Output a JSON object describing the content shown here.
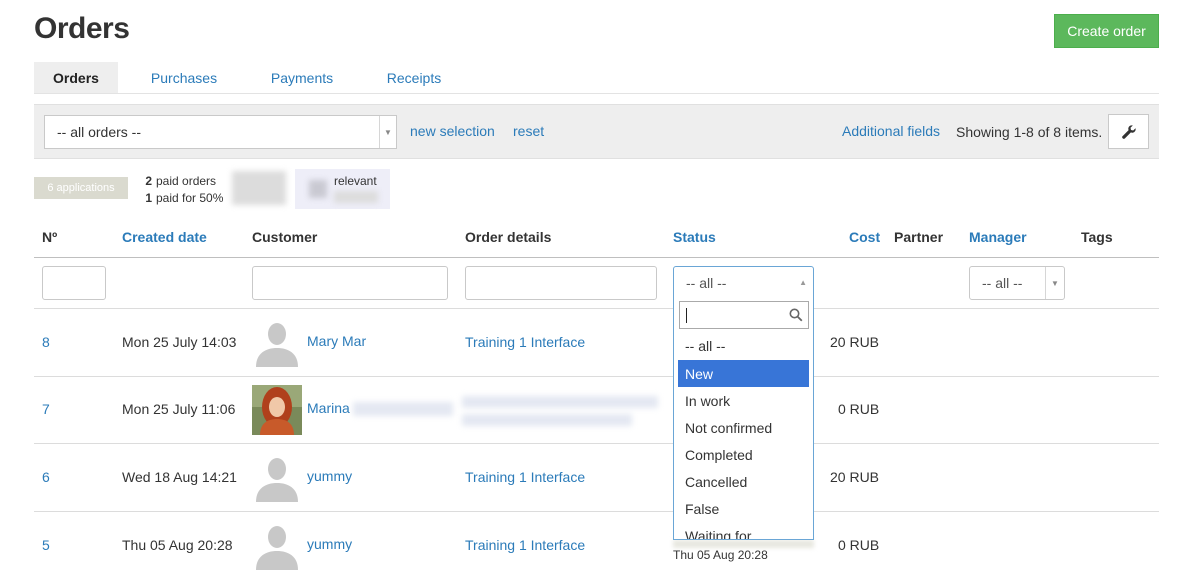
{
  "header": {
    "title": "Orders",
    "create_button": "Create order"
  },
  "tabs": [
    {
      "label": "Orders",
      "active": true
    },
    {
      "label": "Purchases"
    },
    {
      "label": "Payments"
    },
    {
      "label": "Receipts"
    }
  ],
  "filterbar": {
    "order_filter_value": "-- all orders --",
    "new_selection": "new selection",
    "reset": "reset",
    "additional_fields": "Additional fields",
    "showing": "Showing 1-8 of 8 items."
  },
  "summary": {
    "applications": "6 applications",
    "paid_orders_count": "2",
    "paid_orders_label": "paid orders",
    "paid_half_count": "1",
    "paid_half_label": "paid for 50%",
    "relevant_label": "relevant"
  },
  "table": {
    "headers": {
      "number": "Nº",
      "created_date": "Created date",
      "customer": "Customer",
      "order_details": "Order details",
      "status": "Status",
      "cost": "Cost",
      "partner": "Partner",
      "manager": "Manager",
      "tags": "Tags"
    },
    "status_filter_value": "-- all --",
    "manager_filter_value": "-- all --",
    "rows": [
      {
        "number": "8",
        "date": "Mon 25 July 14:03",
        "customer": "Mary Mar",
        "details": "Training 1 Interface",
        "cost": "20 RUB"
      },
      {
        "number": "7",
        "date": "Mon 25 July 11:06",
        "customer": "Marina",
        "details": "",
        "cost": "0 RUB"
      },
      {
        "number": "6",
        "date": "Wed 18 Aug 14:21",
        "customer": "yummy",
        "details": "Training 1 Interface",
        "cost": "20 RUB"
      },
      {
        "number": "5",
        "date": "Thu 05 Aug 20:28",
        "customer": "yummy",
        "details": "Training 1 Interface",
        "cost": "0 RUB",
        "status_date": "Thu 05 Aug 20:28"
      }
    ]
  },
  "status_dropdown": {
    "options": [
      "-- all --",
      "New",
      "In work",
      "Not confirmed",
      "Completed",
      "Cancelled",
      "False",
      "Waiting for"
    ],
    "highlighted": "New"
  },
  "colors": {
    "link": "#2b7bb9",
    "create_button": "#5cb85c",
    "highlight": "#3875d7"
  }
}
